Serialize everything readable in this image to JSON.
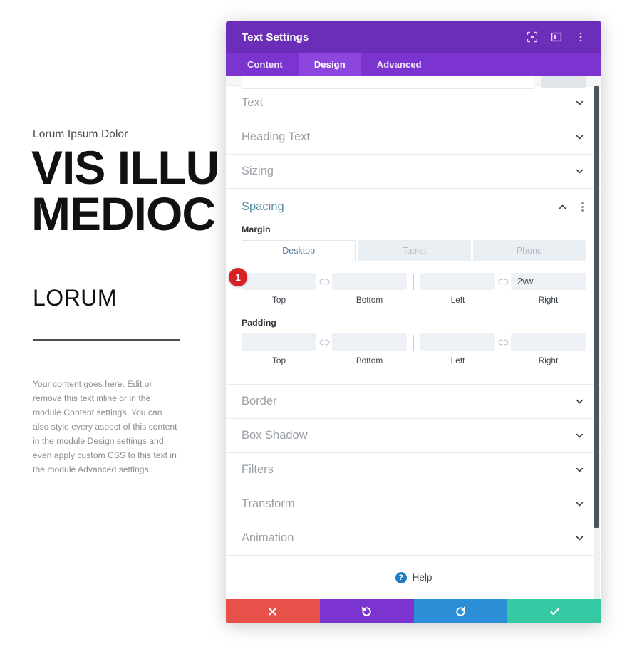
{
  "page_content": {
    "eyebrow": "Lorum Ipsum Dolor",
    "title_line1": "VIS ILLU",
    "title_line2": "MEDIOC",
    "subtitle": "LORUM",
    "body": "Your content goes here. Edit or remove this text inline or in the module Content settings. You can also style every aspect of this content in the module Design settings and even apply custom CSS to this text in the module Advanced settings."
  },
  "panel": {
    "header": {
      "title": "Text Settings",
      "icons": [
        {
          "name": "focus-icon",
          "label": "Focus"
        },
        {
          "name": "layout-columns-icon",
          "label": "Layout"
        },
        {
          "name": "more-vertical-icon",
          "label": "More"
        }
      ]
    },
    "tabs": [
      {
        "label": "Content",
        "active": false
      },
      {
        "label": "Design",
        "active": true
      },
      {
        "label": "Advanced",
        "active": false
      }
    ],
    "sections_above": [
      {
        "label": "Text",
        "expanded": false
      },
      {
        "label": "Heading Text",
        "expanded": false
      },
      {
        "label": "Sizing",
        "expanded": false
      }
    ],
    "spacing": {
      "label": "Spacing",
      "expanded": true,
      "margin": {
        "label": "Margin",
        "responsive": [
          {
            "label": "Desktop",
            "active": true
          },
          {
            "label": "Tablet",
            "active": false
          },
          {
            "label": "Phone",
            "active": false
          }
        ],
        "fields": [
          {
            "caption": "Top",
            "value": "",
            "placeholder": ""
          },
          {
            "caption": "Bottom",
            "value": "",
            "placeholder": ""
          },
          {
            "caption": "Left",
            "value": "",
            "placeholder": ""
          },
          {
            "caption": "Right",
            "value": "2vw",
            "placeholder": ""
          }
        ]
      },
      "padding": {
        "label": "Padding",
        "fields": [
          {
            "caption": "Top",
            "value": "",
            "placeholder": ""
          },
          {
            "caption": "Bottom",
            "value": "",
            "placeholder": ""
          },
          {
            "caption": "Left",
            "value": "",
            "placeholder": ""
          },
          {
            "caption": "Right",
            "value": "",
            "placeholder": ""
          }
        ]
      },
      "step_badge": "1"
    },
    "sections_below": [
      {
        "label": "Border",
        "expanded": false
      },
      {
        "label": "Box Shadow",
        "expanded": false
      },
      {
        "label": "Filters",
        "expanded": false
      },
      {
        "label": "Transform",
        "expanded": false
      },
      {
        "label": "Animation",
        "expanded": false
      }
    ],
    "help": {
      "label": "Help",
      "icon_glyph": "?"
    },
    "footer": [
      {
        "name": "cancel-button",
        "icon": "close-icon",
        "color": "#e8504a"
      },
      {
        "name": "undo-button",
        "icon": "undo-icon",
        "color": "#7b34cf"
      },
      {
        "name": "redo-button",
        "icon": "redo-icon",
        "color": "#2b8ed6"
      },
      {
        "name": "save-button",
        "icon": "check-icon",
        "color": "#34c9a3"
      }
    ],
    "colors": {
      "header_purple": "#6c2eb9",
      "tabbar_purple": "#7b34cf",
      "tab_active_purple": "#8c46dd",
      "spacing_accent": "#5b8fa8",
      "badge_red": "#d81f23"
    }
  }
}
